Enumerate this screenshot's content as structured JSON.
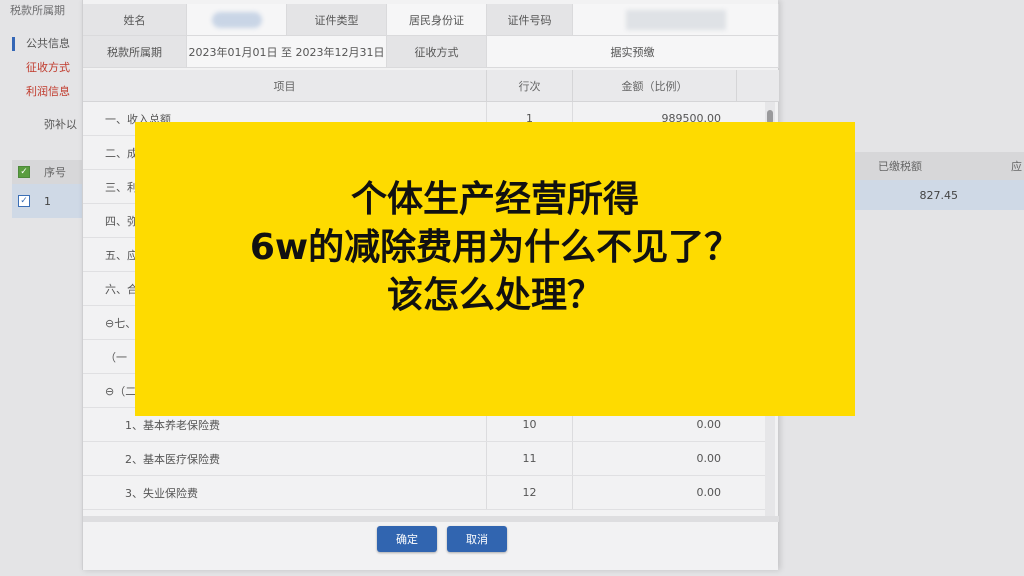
{
  "background": {
    "topbar": "税款所属期",
    "side_items": [
      {
        "label": "公共信息",
        "style": "active"
      },
      {
        "label": "征收方式",
        "style": "red"
      },
      {
        "label": "利润信息",
        "style": "red"
      }
    ],
    "note": "弥补以",
    "table": {
      "header": "序号",
      "row_no": "1"
    },
    "right": {
      "header_a": "已缴税额",
      "header_b": "应",
      "value": "827.45"
    }
  },
  "modal": {
    "info": {
      "name_label": "姓名",
      "cert_type_label": "证件类型",
      "cert_type_value": "居民身份证",
      "cert_no_label": "证件号码",
      "period_label": "税款所属期",
      "period_value": "2023年01月01日 至 2023年12月31日",
      "method_label": "征收方式",
      "method_value": "据实预缴"
    },
    "grid": {
      "headers": [
        "项目",
        "行次",
        "金额（比例）"
      ],
      "rows": [
        {
          "item": "一、收入总额",
          "line": "1",
          "amount": "989500.00"
        },
        {
          "item": "二、成",
          "line": "",
          "amount": ""
        },
        {
          "item": "三、利",
          "line": "",
          "amount": ""
        },
        {
          "item": "四、弥",
          "line": "",
          "amount": ""
        },
        {
          "item": "五、应",
          "line": "",
          "amount": ""
        },
        {
          "item": "六、合",
          "line": "",
          "amount": ""
        },
        {
          "item": "⊖七、允",
          "line": "",
          "amount": ""
        },
        {
          "item": "（一",
          "line": "",
          "amount": ""
        },
        {
          "item": "⊖（二",
          "line": "",
          "amount": ""
        },
        {
          "item": "1、基本养老保险费",
          "line": "10",
          "amount": "0.00"
        },
        {
          "item": "2、基本医疗保险费",
          "line": "11",
          "amount": "0.00"
        },
        {
          "item": "3、失业保险费",
          "line": "12",
          "amount": "0.00"
        }
      ]
    },
    "buttons": {
      "confirm": "确定",
      "cancel": "取消"
    }
  },
  "banner": {
    "line1": "个体生产经营所得",
    "line2": "6w的减除费用为什么不见了？",
    "line3": "该怎么处理？",
    "color": "#fedb00"
  }
}
